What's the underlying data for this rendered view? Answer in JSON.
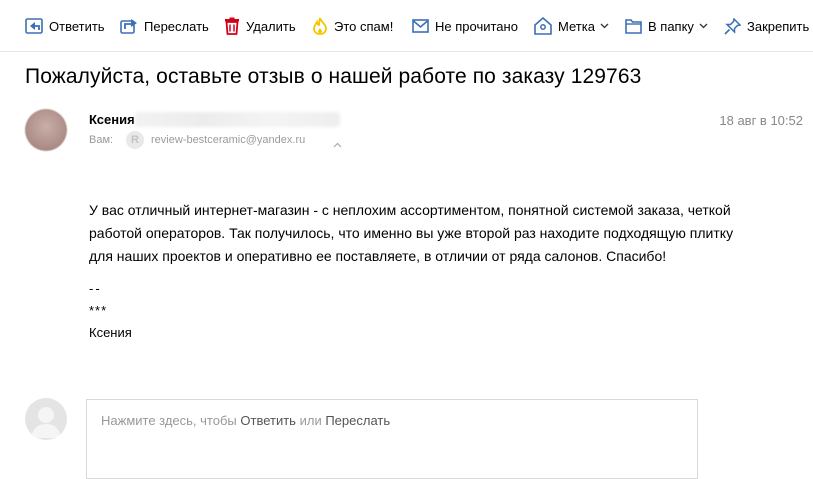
{
  "toolbar": {
    "reply": "Ответить",
    "forward": "Переслать",
    "delete": "Удалить",
    "spam": "Это спам!",
    "unread": "Не прочитано",
    "label": "Метка",
    "folder": "В папку",
    "pin": "Закрепить"
  },
  "message": {
    "subject": "Пожалуйста, оставьте отзыв о нашей работе по заказу 129763",
    "sender_name": "Ксения",
    "to_label": "Вам:",
    "to_avatar_letter": "R",
    "to_address": "review-bestceramic@yandex.ru",
    "date": "18 авг в 10:52",
    "body_lines": [
      "У вас отличный интернет-магазин - с неплохим ассортиментом, понятной системой заказа, четкой",
      "работой операторов. Так получилось, что именно вы уже второй раз находите подходящую плитку",
      "для наших проектов и оперативно ее поставляете, в отличии от ряда салонов. Спасибо!"
    ],
    "signature": [
      "--",
      "***",
      "Ксения"
    ]
  },
  "quick_reply": {
    "prefix": "Нажмите здесь, чтобы",
    "reply_link": "Ответить",
    "or": "или",
    "forward_link": "Переслать"
  },
  "colors": {
    "icon_blue": "#3b6fb6",
    "delete_red": "#d0021b",
    "spam_yellow": "#f7c400"
  }
}
